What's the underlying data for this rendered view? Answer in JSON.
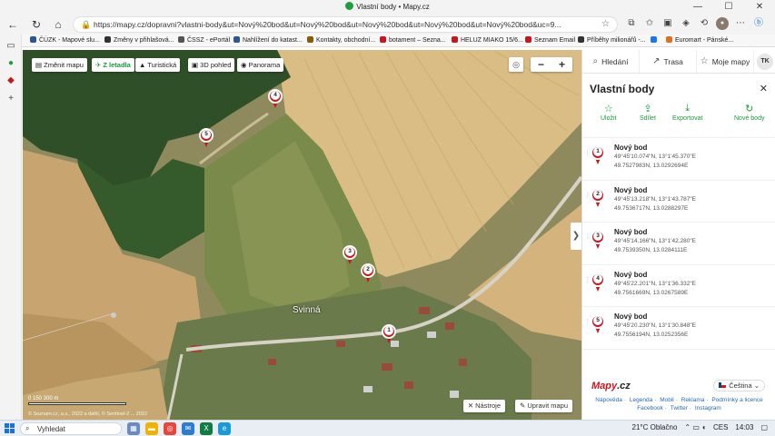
{
  "window": {
    "title": "Vlastní body • Mapy.cz",
    "minimize": "—",
    "maximize": "☐",
    "close": "✕"
  },
  "browser": {
    "url": "https://mapy.cz/dopravni?vlastni-body&ut=Nový%20bod&ut=Nový%20bod&ut=Nový%20bod&ut=Nový%20bod&ut=Nový%20bod&uc=9...",
    "bookmarks": [
      {
        "label": "ČÚZK - Mapové slu...",
        "color": "#2b5797"
      },
      {
        "label": "Změny v přihlašová...",
        "color": "#333333"
      },
      {
        "label": "ČSSZ - ePortál",
        "color": "#555555"
      },
      {
        "label": "Nahlížení do katast...",
        "color": "#2b5797"
      },
      {
        "label": "Kontakty, obchodní...",
        "color": "#8a5a00"
      },
      {
        "label": "botament – Sezna...",
        "color": "#c8161d"
      },
      {
        "label": "HELUZ MIAKO 15/6...",
        "color": "#c8161d"
      },
      {
        "label": "Seznam Email",
        "color": "#c8161d"
      },
      {
        "label": "Příběhy milionářů -...",
        "color": "#333333"
      },
      {
        "label": "",
        "color": "#1877f2"
      },
      {
        "label": "Euromart - Pánské...",
        "color": "#e07020"
      }
    ]
  },
  "map": {
    "buttons": {
      "change_map": "Změnit mapu",
      "aerial": "Z letadla",
      "tourist": "Turistická",
      "view3d": "3D pohled",
      "panorama": "Panorama"
    },
    "zoom_out": "−",
    "zoom_in": "+",
    "village": "Svinná",
    "tools": "Nástroje",
    "edit_map": "Upravit mapu",
    "scale_labels": "0          150          300 m",
    "copyright": "© Seznam.cz, a.s., 2022 a další, © Sentinel-2 ... 2022",
    "pins": [
      "1",
      "2",
      "3",
      "4",
      "5"
    ]
  },
  "panel": {
    "tabs": {
      "search": "Hledání",
      "route": "Trasa",
      "my_maps": "Moje mapy",
      "user": "TK"
    },
    "title": "Vlastní body",
    "close": "✕",
    "actions": {
      "save": "Uložit",
      "share": "Sdílet",
      "export": "Exportovat",
      "new": "Nové body"
    },
    "points": [
      {
        "num": "1",
        "name": "Nový bod",
        "dms": "49°45'10.074\"N, 13°1'45.370\"E",
        "dec": "49.7527983N, 13.0292694E"
      },
      {
        "num": "2",
        "name": "Nový bod",
        "dms": "49°45'13.218\"N, 13°1'43.787\"E",
        "dec": "49.7536717N, 13.0288297E"
      },
      {
        "num": "3",
        "name": "Nový bod",
        "dms": "49°45'14.166\"N, 13°1'42.280\"E",
        "dec": "49.7539350N, 13.0284111E"
      },
      {
        "num": "4",
        "name": "Nový bod",
        "dms": "49°45'22.201\"N, 13°1'36.332\"E",
        "dec": "49.7561669N, 13.0267589E"
      },
      {
        "num": "5",
        "name": "Nový bod",
        "dms": "49°45'20.230\"N, 13°1'30.848\"E",
        "dec": "49.7556194N, 13.0252356E"
      }
    ],
    "logo_a": "Mapy",
    "logo_b": ".cz",
    "language": "Čeština",
    "links1": [
      "Nápověda",
      "Legenda",
      "Mobil",
      "Reklama",
      "Podmínky a licence"
    ],
    "links2": [
      "Facebook",
      "Twitter",
      "Instagram"
    ]
  },
  "taskbar": {
    "search": "Vyhledat",
    "weather": "21°C  Oblačno",
    "lang": "CES",
    "time": "14:03"
  }
}
